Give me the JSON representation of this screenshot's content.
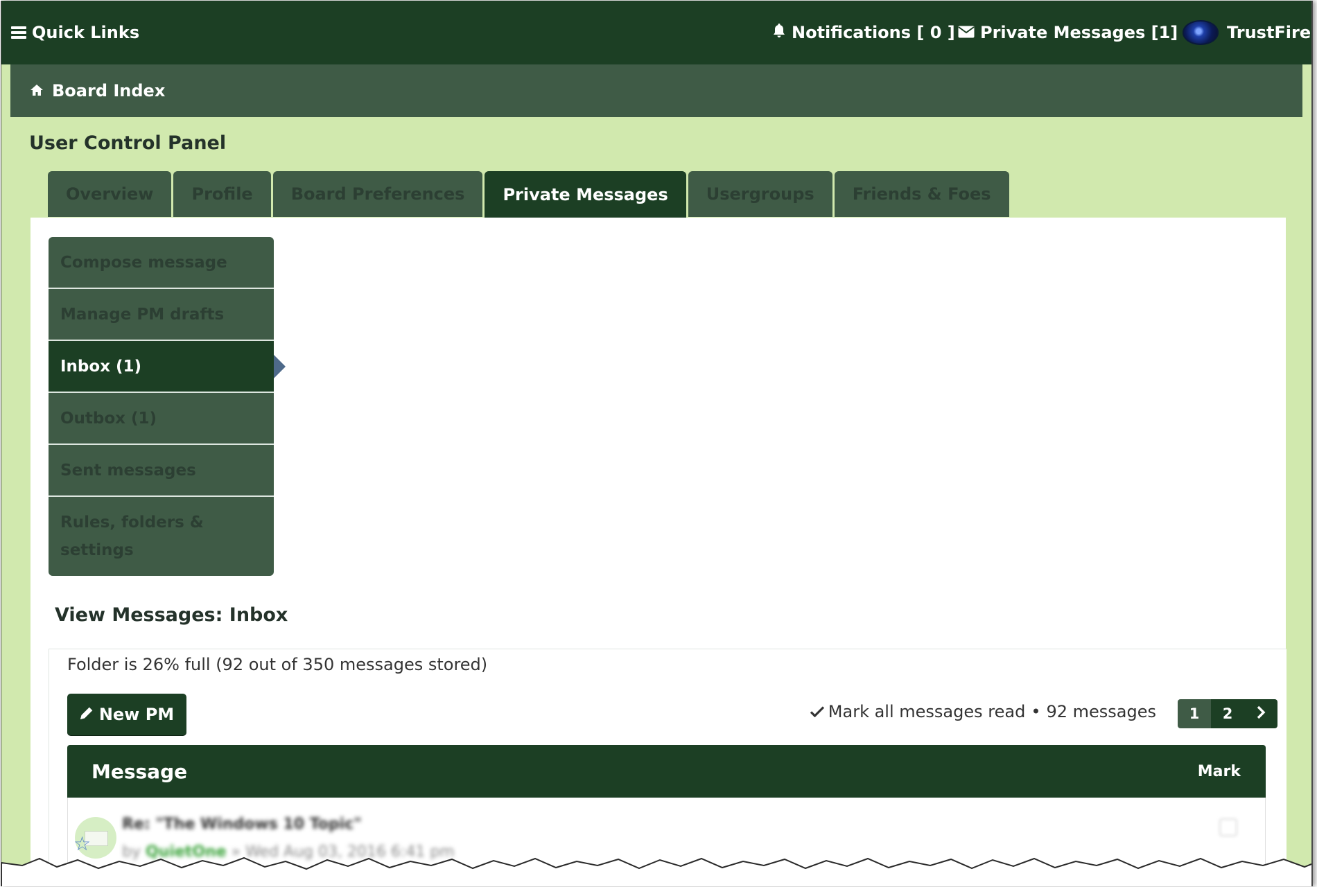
{
  "topbar": {
    "quick_links": "Quick Links",
    "notifications": "Notifications [ 0 ]",
    "private_messages": "Private Messages [1]",
    "username": "TrustFire"
  },
  "breadcrumb": {
    "home": "Board Index"
  },
  "page_title": "User Control Panel",
  "tabs": [
    {
      "label": "Overview"
    },
    {
      "label": "Profile"
    },
    {
      "label": "Board Preferences"
    },
    {
      "label": "Private Messages",
      "active": true
    },
    {
      "label": "Usergroups"
    },
    {
      "label": "Friends & Foes"
    }
  ],
  "side_menu": [
    {
      "label": "Compose message"
    },
    {
      "label": "Manage PM drafts"
    },
    {
      "label": "Inbox (1)",
      "active": true
    },
    {
      "label": "Outbox (1)"
    },
    {
      "label": "Sent messages"
    },
    {
      "label": "Rules, folders & settings"
    }
  ],
  "view_title": "View Messages: Inbox",
  "folder_info": "Folder is 26% full (92 out of 350 messages stored)",
  "new_pm_label": "New PM",
  "actions": {
    "mark_all_read": "Mark all messages read",
    "separator": "•",
    "message_count": "92 messages"
  },
  "pagination": {
    "pages": [
      "1",
      "2"
    ],
    "current": "1"
  },
  "table_header": {
    "message": "Message",
    "mark": "Mark"
  },
  "message_row": {
    "subject": "Re: \"The Windows 10 Topic\"",
    "by": "by",
    "author": "QuietOne",
    "date": "» Wed Aug 03, 2016 6:41 pm"
  },
  "colors": {
    "navbar": "#1c3f24",
    "breadcrumb": "#3f5b46",
    "background": "#d1e9ae",
    "accent_link": "#3aa33a"
  }
}
